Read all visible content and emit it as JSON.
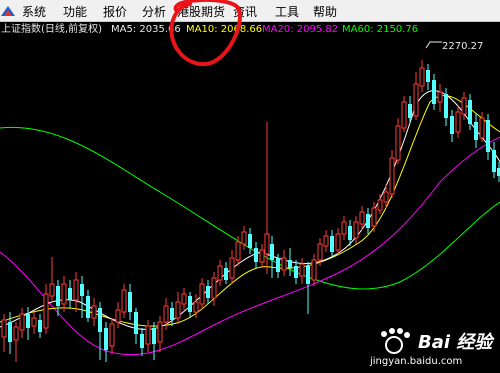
{
  "menu": {
    "items": [
      "系统",
      "功能",
      "报价",
      "分析",
      "港股期货",
      "资讯",
      "工具",
      "帮助"
    ]
  },
  "info": {
    "title": "上证指数(日线,前复权)",
    "ma5": "MA5: 2035.66",
    "ma10": "MA10: 2068.66",
    "ma20": "MA20: 2095.82",
    "ma60": "MA60: 2150.76"
  },
  "chart": {
    "high_label": "2270.27",
    "colors": {
      "up": "#ff3c3c",
      "down": "#54ffff",
      "ma5": "#ffffff",
      "ma10": "#ffff00",
      "ma20": "#ff00ff",
      "ma60": "#00ff00"
    }
  },
  "watermark": {
    "brand": "Bai 经验",
    "url": "jingyan.baidu.com"
  }
}
